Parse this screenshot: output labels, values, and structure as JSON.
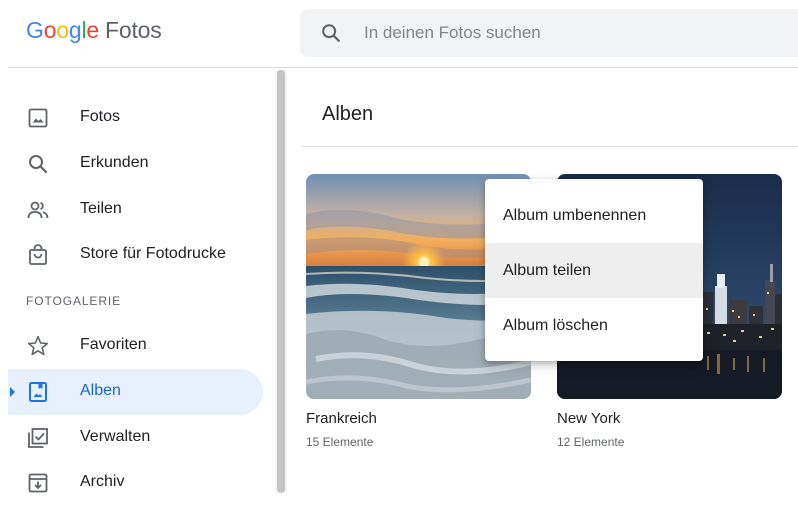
{
  "header": {
    "logo_letters": [
      "G",
      "o",
      "o",
      "g",
      "l",
      "e"
    ],
    "product": "Fotos",
    "search": {
      "placeholder": "In deinen Fotos suchen"
    }
  },
  "sidebar": {
    "items": [
      {
        "label": "Fotos",
        "icon": "photo-icon"
      },
      {
        "label": "Erkunden",
        "icon": "search-icon"
      },
      {
        "label": "Teilen",
        "icon": "people-icon"
      },
      {
        "label": "Store für Fotodrucke",
        "icon": "shopping-bag-icon"
      }
    ],
    "section_label": "FOTOGALERIE",
    "library": [
      {
        "label": "Favoriten",
        "icon": "star-icon"
      },
      {
        "label": "Alben",
        "icon": "album-icon",
        "active": true
      },
      {
        "label": "Verwalten",
        "icon": "utilities-icon"
      },
      {
        "label": "Archiv",
        "icon": "archive-icon"
      }
    ]
  },
  "main": {
    "title": "Alben",
    "albums": [
      {
        "name": "Frankreich",
        "count": "15 Elemente",
        "image": "sunset-beach"
      },
      {
        "name": "New York",
        "count": "12 Elemente",
        "image": "city-skyline-night"
      }
    ]
  },
  "context_menu": {
    "items": [
      {
        "label": "Album umbenennen"
      },
      {
        "label": "Album teilen",
        "highlighted": true
      },
      {
        "label": "Album löschen"
      }
    ]
  },
  "colors": {
    "accent": "#1a73e8",
    "active_bg": "#e8f0fe",
    "active_text": "#1967d2",
    "menu_hover": "#eeeeee"
  }
}
